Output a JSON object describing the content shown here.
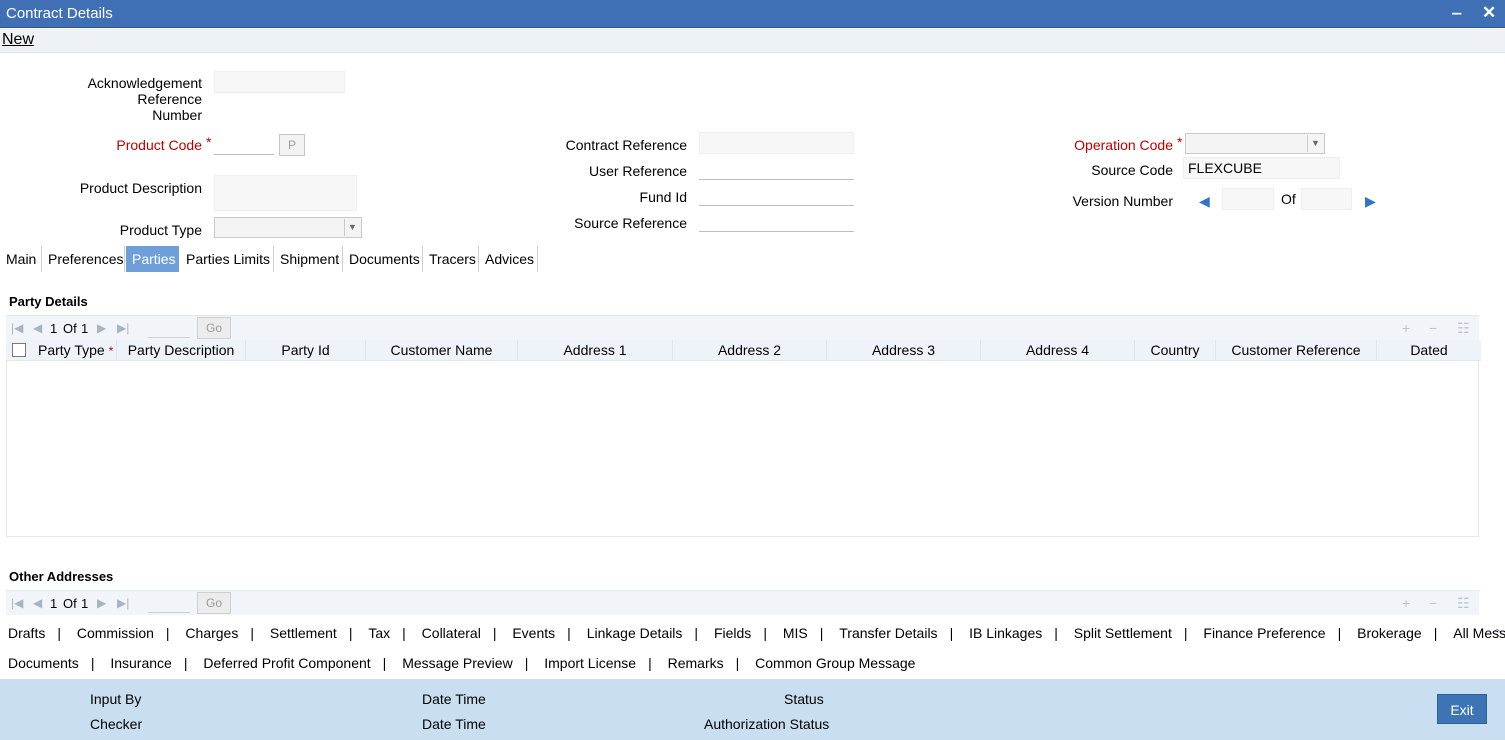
{
  "window": {
    "title": "Contract Details",
    "minimize": "‒",
    "close": "✕"
  },
  "menu": {
    "new": "New"
  },
  "form": {
    "ack_ref_label_1": "Acknowledgement Reference",
    "ack_ref_label_2": "Number",
    "product_code_label": "Product Code",
    "product_code_button": "P",
    "product_description_label": "Product Description",
    "product_type_label": "Product Type",
    "contract_reference_label": "Contract Reference",
    "user_reference_label": "User Reference",
    "fund_id_label": "Fund Id",
    "source_reference_label": "Source Reference",
    "operation_code_label": "Operation Code",
    "source_code_label": "Source Code",
    "source_code_value": "FLEXCUBE",
    "version_number_label": "Version Number",
    "version_of": "Of",
    "required_mark": "*"
  },
  "tabs": [
    "Main",
    "Preferences",
    "Parties",
    "Parties Limits",
    "Shipment",
    "Documents",
    "Tracers",
    "Advices"
  ],
  "active_tab": "Parties",
  "party_details": {
    "title": "Party Details",
    "pager": {
      "page": "1",
      "of": "Of",
      "total": "1",
      "go": "Go"
    },
    "columns": [
      "Party Type",
      "Party Description",
      "Party Id",
      "Customer Name",
      "Address 1",
      "Address 2",
      "Address 3",
      "Address 4",
      "Country",
      "Customer Reference",
      "Dated"
    ]
  },
  "other_addresses": {
    "title": "Other Addresses",
    "pager": {
      "page": "1",
      "of": "Of",
      "total": "1",
      "go": "Go"
    }
  },
  "links_row1": [
    "Drafts",
    "Commission",
    "Charges",
    "Settlement",
    "Tax",
    "Collateral",
    "Events",
    "Linkage Details",
    "Fields",
    "MIS",
    "Transfer Details",
    "IB Linkages",
    "Split Settlement",
    "Finance Preference",
    "Brokerage",
    "All Messages"
  ],
  "links_row2": [
    "Documents",
    "Insurance",
    "Deferred Profit Component",
    "Message Preview",
    "Import License",
    "Remarks",
    "Common Group Message"
  ],
  "footer": {
    "input_by": "Input By",
    "checker": "Checker",
    "date_time_1": "Date Time",
    "date_time_2": "Date Time",
    "status": "Status",
    "authorization_status": "Authorization Status",
    "exit": "Exit"
  },
  "colors": {
    "titlebar": "#3f6fb4",
    "active_tab": "#6e9fd8",
    "required": "#c00000",
    "footer": "#c9def0",
    "exit_button": "#3d74b5"
  }
}
